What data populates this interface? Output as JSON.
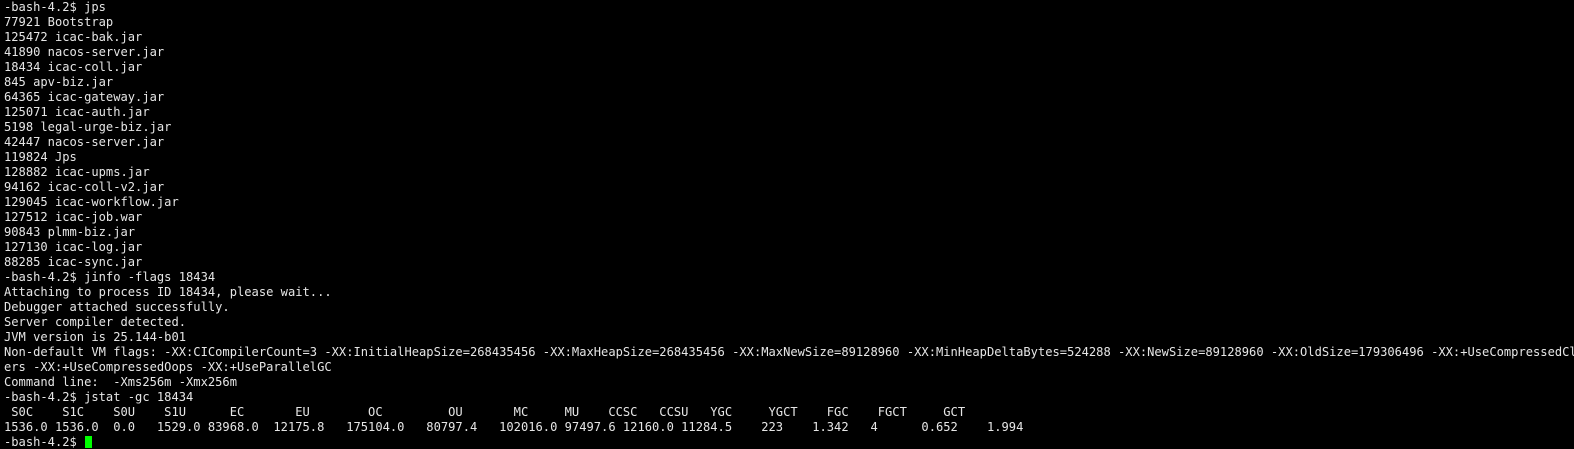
{
  "terminal": {
    "text_color": "#e6e6e6",
    "background_color": "#000000",
    "cursor_color": "#00ff00",
    "lines": [
      "-bash-4.2$ jps",
      "77921 Bootstrap",
      "125472 icac-bak.jar",
      "41890 nacos-server.jar",
      "18434 icac-coll.jar",
      "845 apv-biz.jar",
      "64365 icac-gateway.jar",
      "125071 icac-auth.jar",
      "5198 legal-urge-biz.jar",
      "42447 nacos-server.jar",
      "119824 Jps",
      "128882 icac-upms.jar",
      "94162 icac-coll-v2.jar",
      "129045 icac-workflow.jar",
      "127512 icac-job.war",
      "90843 plmm-biz.jar",
      "127130 icac-log.jar",
      "88285 icac-sync.jar",
      "-bash-4.2$ jinfo -flags 18434",
      "Attaching to process ID 18434, please wait...",
      "Debugger attached successfully.",
      "Server compiler detected.",
      "JVM version is 25.144-b01",
      "Non-default VM flags: -XX:CICompilerCount=3 -XX:InitialHeapSize=268435456 -XX:MaxHeapSize=268435456 -XX:MaxNewSize=89128960 -XX:MinHeapDeltaBytes=524288 -XX:NewSize=89128960 -XX:OldSize=179306496 -XX:+UseCompressedClassPoint",
      "ers -XX:+UseCompressedOops -XX:+UseParallelGC",
      "Command line:  -Xms256m -Xmx256m",
      "-bash-4.2$ jstat -gc 18434",
      " S0C    S1C    S0U    S1U      EC       EU        OC         OU       MC     MU    CCSC   CCSU   YGC     YGCT    FGC    FGCT     GCT",
      "1536.0 1536.0  0.0   1529.0 83968.0  12175.8   175104.0   80797.4   102016.0 97497.6 12160.0 11284.5    223    1.342   4      0.652    1.994"
    ],
    "prompt": "-bash-4.2$ "
  }
}
